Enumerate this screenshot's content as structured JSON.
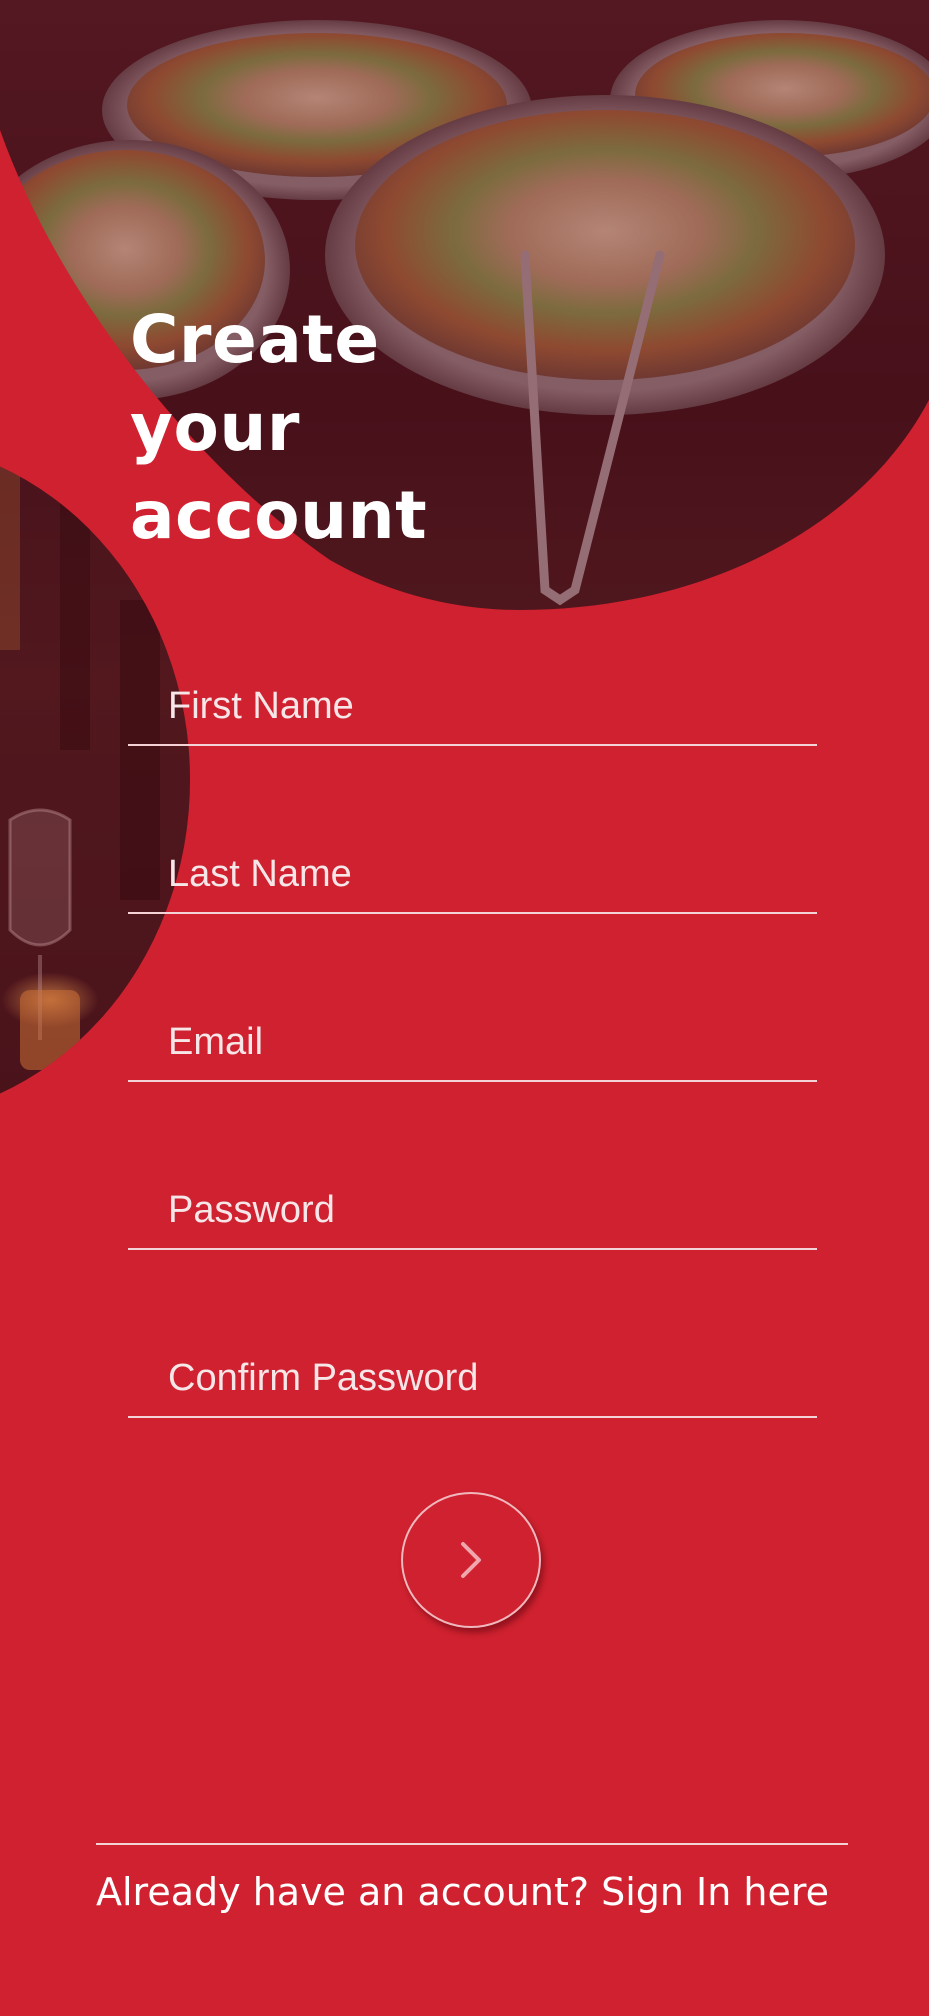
{
  "header": {
    "title_lines": [
      "Create",
      "your",
      "account"
    ]
  },
  "form": {
    "fields": [
      {
        "placeholder": "First Name",
        "value": ""
      },
      {
        "placeholder": "Last Name",
        "value": ""
      },
      {
        "placeholder": "Email",
        "value": ""
      },
      {
        "placeholder": "Password",
        "value": ""
      },
      {
        "placeholder": "Confirm Password",
        "value": ""
      }
    ],
    "next_icon": "chevron-right-icon"
  },
  "footer": {
    "signin_text": "Already have an account? Sign In here"
  },
  "colors": {
    "primary_red": "#cf212f",
    "text_white": "#ffffff",
    "divider": "#f4d2d5"
  }
}
